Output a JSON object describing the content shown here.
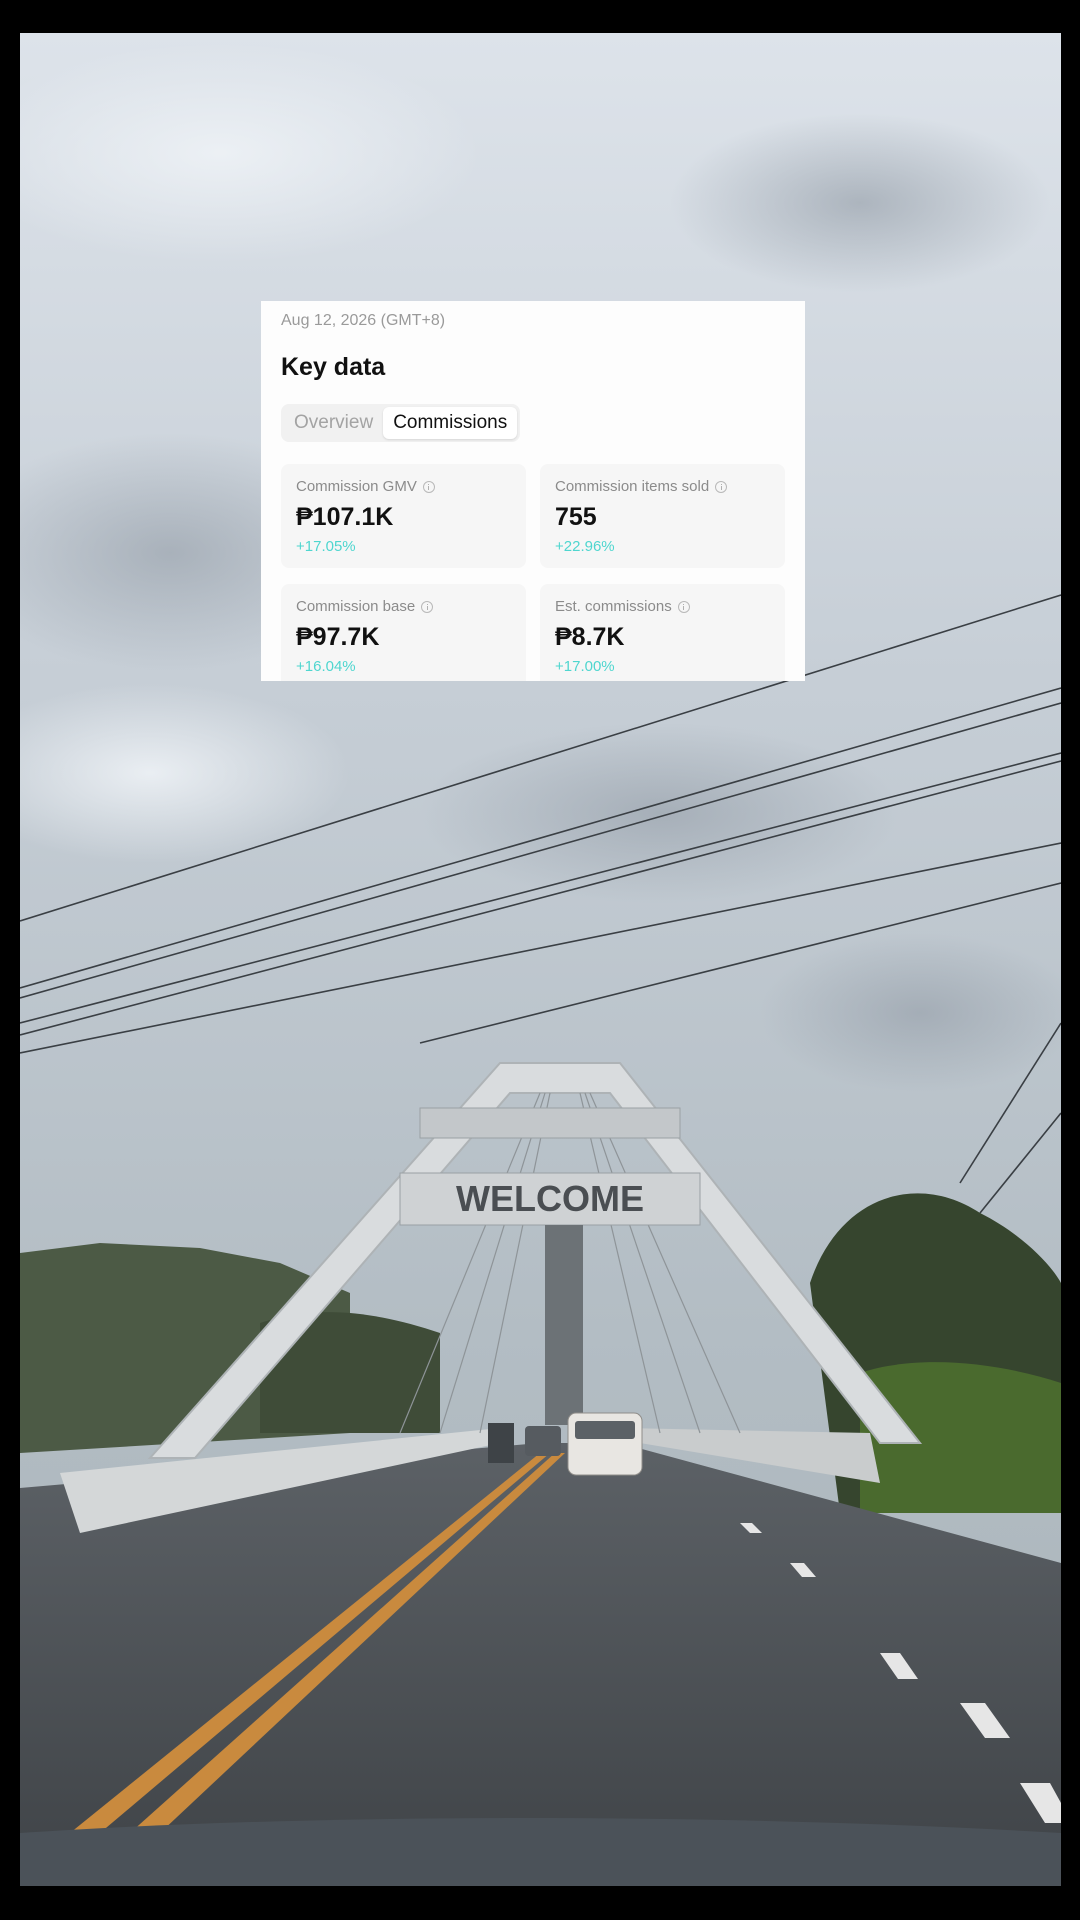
{
  "card": {
    "date": "Aug 12, 2026 (GMT+8)",
    "title": "Key data",
    "tabs": [
      {
        "label": "Overview",
        "active": false
      },
      {
        "label": "Commissions",
        "active": true
      }
    ],
    "metrics": [
      {
        "label": "Commission GMV",
        "value": "₱107.1K",
        "change": "+17.05%"
      },
      {
        "label": "Commission items sold",
        "value": "755",
        "change": "+22.96%"
      },
      {
        "label": "Commission base",
        "value": "₱97.7K",
        "change": "+16.04%"
      },
      {
        "label": "Est. commissions",
        "value": "₱8.7K",
        "change": "+17.00%"
      }
    ]
  },
  "background": {
    "sign_text": "WELCOME"
  },
  "colors": {
    "change_positive": "#4fd6cf",
    "card_background": "#fdfdfd",
    "metric_background": "#f6f6f6"
  }
}
